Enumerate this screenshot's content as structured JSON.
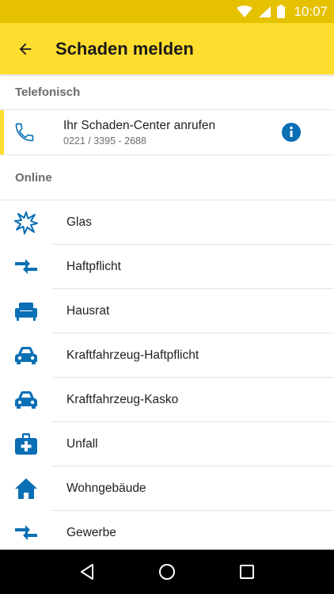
{
  "status_bar": {
    "time": "10:07"
  },
  "app_bar": {
    "title": "Schaden melden"
  },
  "sections": {
    "phone": {
      "header": "Telefonisch",
      "item": {
        "primary": "Ihr Schaden-Center anrufen",
        "secondary": "0221 / 3395 - 2688"
      }
    },
    "online": {
      "header": "Online"
    }
  },
  "claims": [
    {
      "label": "Glas",
      "icon": "broken-glass-icon"
    },
    {
      "label": "Haftpflicht",
      "icon": "arrows-exchange-icon"
    },
    {
      "label": "Hausrat",
      "icon": "armchair-icon"
    },
    {
      "label": "Kraftfahrzeug-Haftpflicht",
      "icon": "car-icon"
    },
    {
      "label": "Kraftfahrzeug-Kasko",
      "icon": "car-icon"
    },
    {
      "label": "Unfall",
      "icon": "first-aid-kit-icon"
    },
    {
      "label": "Wohngebäude",
      "icon": "house-icon"
    },
    {
      "label": "Gewerbe",
      "icon": "arrows-exchange-icon"
    }
  ],
  "colors": {
    "accent": "#ffdd2e",
    "status_bar": "#e6c100",
    "icon_blue": "#0a6fb4"
  }
}
